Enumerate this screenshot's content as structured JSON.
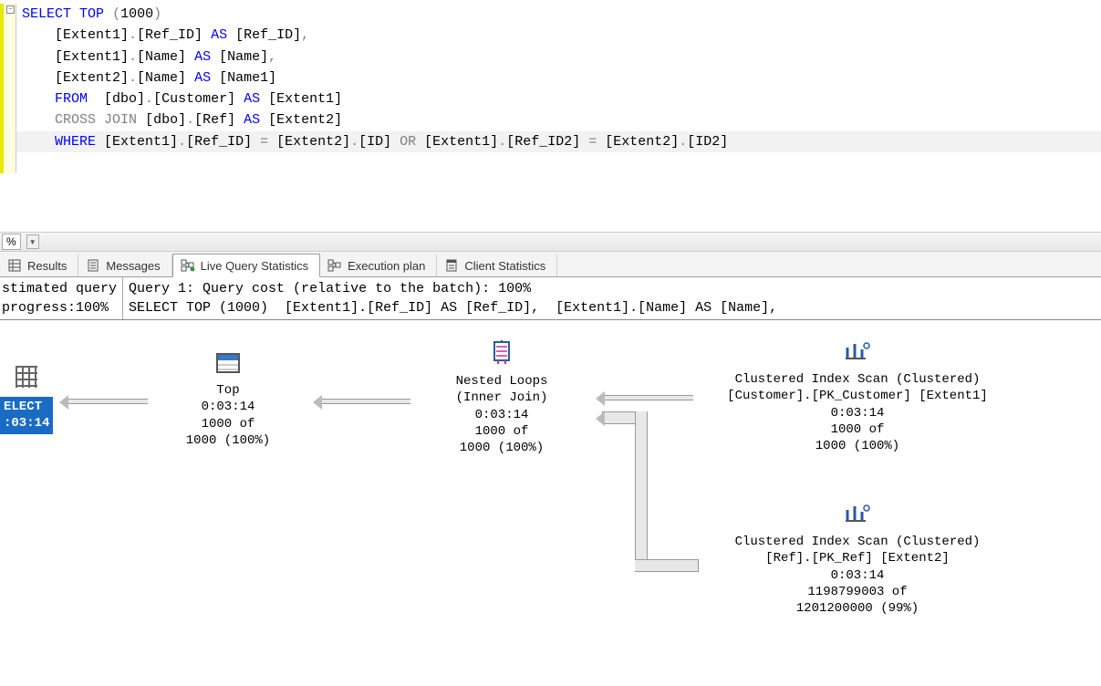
{
  "editor": {
    "collapse_glyph": "−",
    "sql_tokens": [
      [
        {
          "t": "SELECT",
          "c": "kw-blue"
        },
        {
          "t": " ",
          "c": ""
        },
        {
          "t": "TOP",
          "c": "kw-blue"
        },
        {
          "t": " ",
          "c": ""
        },
        {
          "t": "(",
          "c": "kw-gray"
        },
        {
          "t": "1000",
          "c": ""
        },
        {
          "t": ")",
          "c": "kw-gray"
        }
      ],
      [
        {
          "t": "    [Extent1]",
          "c": ""
        },
        {
          "t": ".",
          "c": "kw-gray"
        },
        {
          "t": "[Ref_ID] ",
          "c": ""
        },
        {
          "t": "AS",
          "c": "kw-blue"
        },
        {
          "t": " [Ref_ID]",
          "c": ""
        },
        {
          "t": ",",
          "c": "kw-gray"
        }
      ],
      [
        {
          "t": "    [Extent1]",
          "c": ""
        },
        {
          "t": ".",
          "c": "kw-gray"
        },
        {
          "t": "[Name] ",
          "c": ""
        },
        {
          "t": "AS",
          "c": "kw-blue"
        },
        {
          "t": " [Name]",
          "c": ""
        },
        {
          "t": ",",
          "c": "kw-gray"
        }
      ],
      [
        {
          "t": "    [Extent2]",
          "c": ""
        },
        {
          "t": ".",
          "c": "kw-gray"
        },
        {
          "t": "[Name] ",
          "c": ""
        },
        {
          "t": "AS",
          "c": "kw-blue"
        },
        {
          "t": " [Name1]",
          "c": ""
        }
      ],
      [
        {
          "t": "    ",
          "c": ""
        },
        {
          "t": "FROM",
          "c": "kw-blue"
        },
        {
          "t": "  [dbo]",
          "c": ""
        },
        {
          "t": ".",
          "c": "kw-gray"
        },
        {
          "t": "[Customer] ",
          "c": ""
        },
        {
          "t": "AS",
          "c": "kw-blue"
        },
        {
          "t": " [Extent1]",
          "c": ""
        }
      ],
      [
        {
          "t": "    ",
          "c": ""
        },
        {
          "t": "CROSS",
          "c": "kw-gray"
        },
        {
          "t": " ",
          "c": ""
        },
        {
          "t": "JOIN",
          "c": "kw-gray"
        },
        {
          "t": " [dbo]",
          "c": ""
        },
        {
          "t": ".",
          "c": "kw-gray"
        },
        {
          "t": "[Ref] ",
          "c": ""
        },
        {
          "t": "AS",
          "c": "kw-blue"
        },
        {
          "t": " [Extent2]",
          "c": ""
        }
      ],
      [
        {
          "t": "    ",
          "c": ""
        },
        {
          "t": "WHERE",
          "c": "kw-blue"
        },
        {
          "t": " [Extent1]",
          "c": ""
        },
        {
          "t": ".",
          "c": "kw-gray"
        },
        {
          "t": "[Ref_ID] ",
          "c": ""
        },
        {
          "t": "=",
          "c": "kw-gray"
        },
        {
          "t": " [Extent2]",
          "c": ""
        },
        {
          "t": ".",
          "c": "kw-gray"
        },
        {
          "t": "[ID] ",
          "c": ""
        },
        {
          "t": "OR",
          "c": "kw-gray"
        },
        {
          "t": " [Extent1]",
          "c": ""
        },
        {
          "t": ".",
          "c": "kw-gray"
        },
        {
          "t": "[Ref_ID2] ",
          "c": ""
        },
        {
          "t": "=",
          "c": "kw-gray"
        },
        {
          "t": " [Extent2]",
          "c": ""
        },
        {
          "t": ".",
          "c": "kw-gray"
        },
        {
          "t": "[ID2]",
          "c": ""
        }
      ]
    ],
    "highlighted_line_index": 6
  },
  "splitter": {
    "percent": "%"
  },
  "tabs": {
    "items": [
      {
        "label": "Results",
        "active": false
      },
      {
        "label": "Messages",
        "active": false
      },
      {
        "label": "Live Query Statistics",
        "active": true
      },
      {
        "label": "Execution plan",
        "active": false
      },
      {
        "label": "Client Statistics",
        "active": false
      }
    ]
  },
  "status": {
    "left_line1": "stimated query",
    "left_line2": "progress:100%",
    "right_line1": "Query 1: Query cost (relative to the batch): 100%",
    "right_line2": "SELECT TOP (1000)  [Extent1].[Ref_ID] AS [Ref_ID],  [Extent1].[Name] AS [Name],"
  },
  "plan": {
    "select": {
      "label": "ELECT",
      "time": ":03:14"
    },
    "top": {
      "title": "Top",
      "time": "0:03:14",
      "rows_a": "1000 of",
      "rows_b": "1000 (100%)"
    },
    "nl": {
      "title": "Nested Loops",
      "sub": "(Inner Join)",
      "time": "0:03:14",
      "rows_a": "1000 of",
      "rows_b": "1000 (100%)"
    },
    "scan1": {
      "title": "Clustered Index Scan (Clustered)",
      "sub": "[Customer].[PK_Customer] [Extent1]",
      "time": "0:03:14",
      "rows_a": "1000 of",
      "rows_b": "1000 (100%)"
    },
    "scan2": {
      "title": "Clustered Index Scan (Clustered)",
      "sub": "[Ref].[PK_Ref] [Extent2]",
      "time": "0:03:14",
      "rows_a": "1198799003 of",
      "rows_b": "1201200000 (99%)"
    }
  }
}
